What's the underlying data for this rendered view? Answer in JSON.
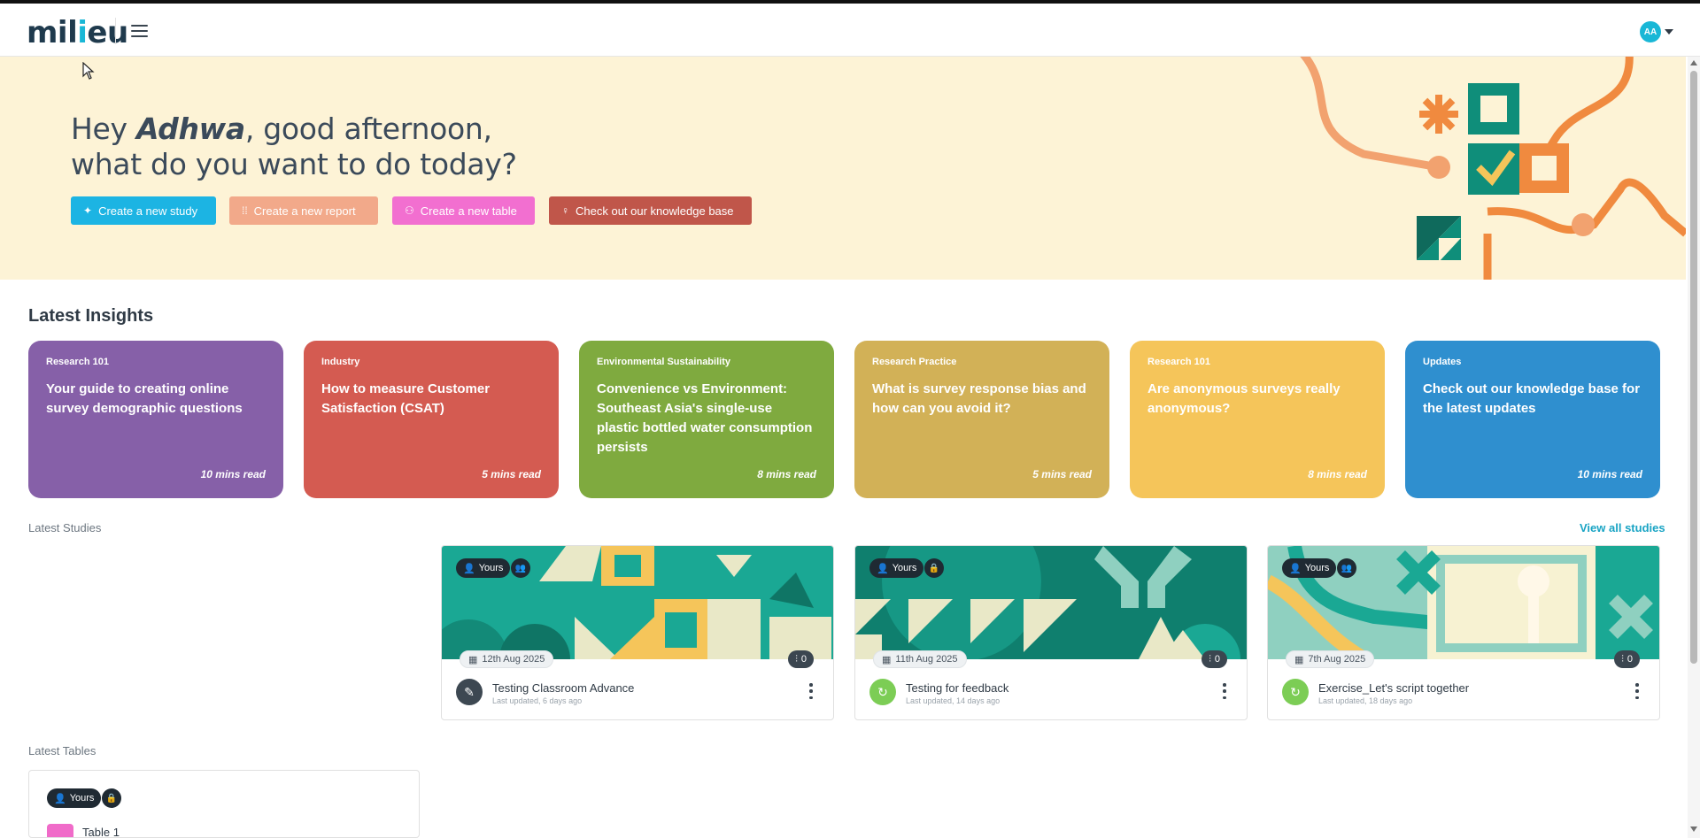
{
  "header": {
    "logo_text_a": "mil",
    "logo_dot": "i",
    "logo_text_b": "eu",
    "avatar_initials": "AA"
  },
  "hero": {
    "greeting_prefix": "Hey ",
    "user_name": "Adhwa",
    "greeting_suffix": ", good afternoon,",
    "line2": "what do you want to do today?",
    "buttons": [
      {
        "label": "Create a new study",
        "color": "#1cb4e3"
      },
      {
        "label": "Create a new report",
        "color": "#f2a98a"
      },
      {
        "label": "Create a new table",
        "color": "#f26fd0"
      },
      {
        "label": "Check out our knowledge base",
        "color": "#c0564a"
      }
    ]
  },
  "insights": {
    "title": "Latest Insights",
    "cards": [
      {
        "category": "Research 101",
        "title": "Your guide to creating online survey demographic questions",
        "read": "10 mins read",
        "color": "#8660a8"
      },
      {
        "category": "Industry",
        "title": "How to measure Customer Satisfaction (CSAT)",
        "read": "5 mins read",
        "color": "#d45b51"
      },
      {
        "category": "Environmental Sustainability",
        "title": "Convenience vs Environment: Southeast Asia's single-use plastic bottled water consumption persists",
        "read": "8 mins read",
        "color": "#7faa3f"
      },
      {
        "category": "Research Practice",
        "title": "What is survey response bias and how can you avoid it?",
        "read": "5 mins read",
        "color": "#d2b157"
      },
      {
        "category": "Research 101",
        "title": "Are anonymous surveys really anonymous?",
        "read": "8 mins read",
        "color": "#f5c55a"
      },
      {
        "category": "Updates",
        "title": "Check out our knowledge base for the latest updates",
        "read": "10 mins read",
        "color": "#2f8fcf"
      }
    ]
  },
  "studies": {
    "title": "Latest Studies",
    "view_all": "View all studies",
    "items": [
      {
        "owner": "Yours",
        "date": "12th Aug 2025",
        "count": "0",
        "name": "Testing Classroom Advance",
        "updated": "Last updated, 6 days ago",
        "status_color": "#3d4852",
        "status_glyph": "✎",
        "access_icon": "group-icon"
      },
      {
        "owner": "Yours",
        "date": "11th Aug 2025",
        "count": "0",
        "name": "Testing for feedback",
        "updated": "Last updated, 14 days ago",
        "status_color": "#7ccd55",
        "status_glyph": "↻",
        "access_icon": "lock-icon"
      },
      {
        "owner": "Yours",
        "date": "7th Aug 2025",
        "count": "0",
        "name": "Exercise_Let's script together",
        "updated": "Last updated, 18 days ago",
        "status_color": "#7ccd55",
        "status_glyph": "↻",
        "access_icon": "group-icon"
      }
    ]
  },
  "tables": {
    "title": "Latest Tables",
    "items": [
      {
        "owner": "Yours",
        "name": "Table 1"
      }
    ]
  }
}
